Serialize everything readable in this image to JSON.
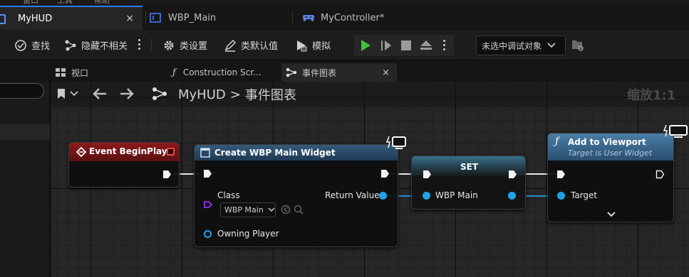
{
  "top_menu": [
    "窗口",
    "工具",
    "帮助"
  ],
  "asset_tabs": [
    {
      "label": "MyHUD",
      "active": true
    },
    {
      "label": "WBP_Main",
      "active": false
    },
    {
      "label": "MyController*",
      "active": false
    }
  ],
  "close_glyph": "×",
  "toolbar": {
    "find": "查找",
    "hide_unrelated": "隐藏不相关",
    "class_settings": "类设置",
    "class_defaults": "类默认值",
    "simulate": "模拟",
    "debug_target": "未选中调试对象"
  },
  "doc_tabs": [
    {
      "label": "视口"
    },
    {
      "label": "Construction Scr..."
    },
    {
      "label": "事件图表",
      "active": true
    }
  ],
  "breadcrumb": {
    "root": "MyHUD",
    "separator": ">",
    "current": "事件图表"
  },
  "zoom_label": "缩放1:1",
  "nodes": {
    "event_begin_play": {
      "title": "Event BeginPlay",
      "color": "#7a1414"
    },
    "create_widget": {
      "title": "Create WBP Main Widget",
      "class_label": "Class",
      "class_value": "WBP Main",
      "owning_player": "Owning Player",
      "return_value": "Return Value",
      "color": "#2c4a66"
    },
    "set_node": {
      "title": "SET",
      "var": "WBP Main"
    },
    "add_to_viewport": {
      "title": "Add to Viewport",
      "subtitle": "Target is User Widget",
      "target": "Target",
      "color": "#3a6a8e"
    }
  },
  "icons": [
    "bookmark-icon",
    "back-arrow-icon",
    "forward-arrow-icon",
    "graph-icon",
    "play-icon",
    "step-icon",
    "stop-icon",
    "eject-icon",
    "function-icon",
    "close-icon",
    "chevron-down-icon"
  ],
  "colors": {
    "exec_wire": "#e6e6e6",
    "object_pin": "#1fa3e6",
    "class_pin": "#8a2be2",
    "accent": "#2f7cf6",
    "play_green": "#3fbf3f"
  }
}
